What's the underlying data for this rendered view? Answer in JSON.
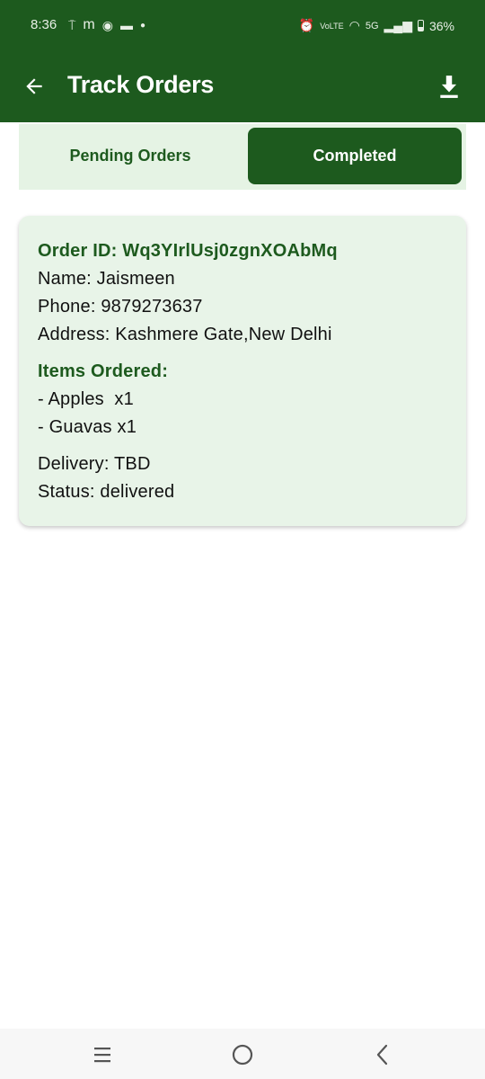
{
  "status_bar": {
    "time": "8:36",
    "notification_icons": [
      "signal-tower-icon",
      "m-app-icon",
      "whatsapp-icon",
      "message-icon",
      "dot-icon"
    ],
    "network": "5G",
    "battery": "36%"
  },
  "app_bar": {
    "title": "Track Orders",
    "back_icon": "arrow-left-icon",
    "download_icon": "download-icon"
  },
  "tabs": [
    {
      "label": "Pending Orders",
      "selected": false
    },
    {
      "label": "Completed",
      "selected": true
    }
  ],
  "order": {
    "order_id": "Order ID: Wq3YIrlUsj0zgnXOAbMq",
    "name": "Name: Jaismeen",
    "phone": "Phone: 9879273637",
    "address": "Address: Kashmere Gate,New Delhi",
    "items_heading": "Items Ordered:",
    "items": [
      "- Apples  x1",
      "- Guavas x1"
    ],
    "delivery": "Delivery: TBD",
    "status": "Status: delivered"
  },
  "colors": {
    "primary": "#1d5a1e",
    "tab_bg": "#e5f3e4",
    "card_bg": "#e8f4e8"
  }
}
